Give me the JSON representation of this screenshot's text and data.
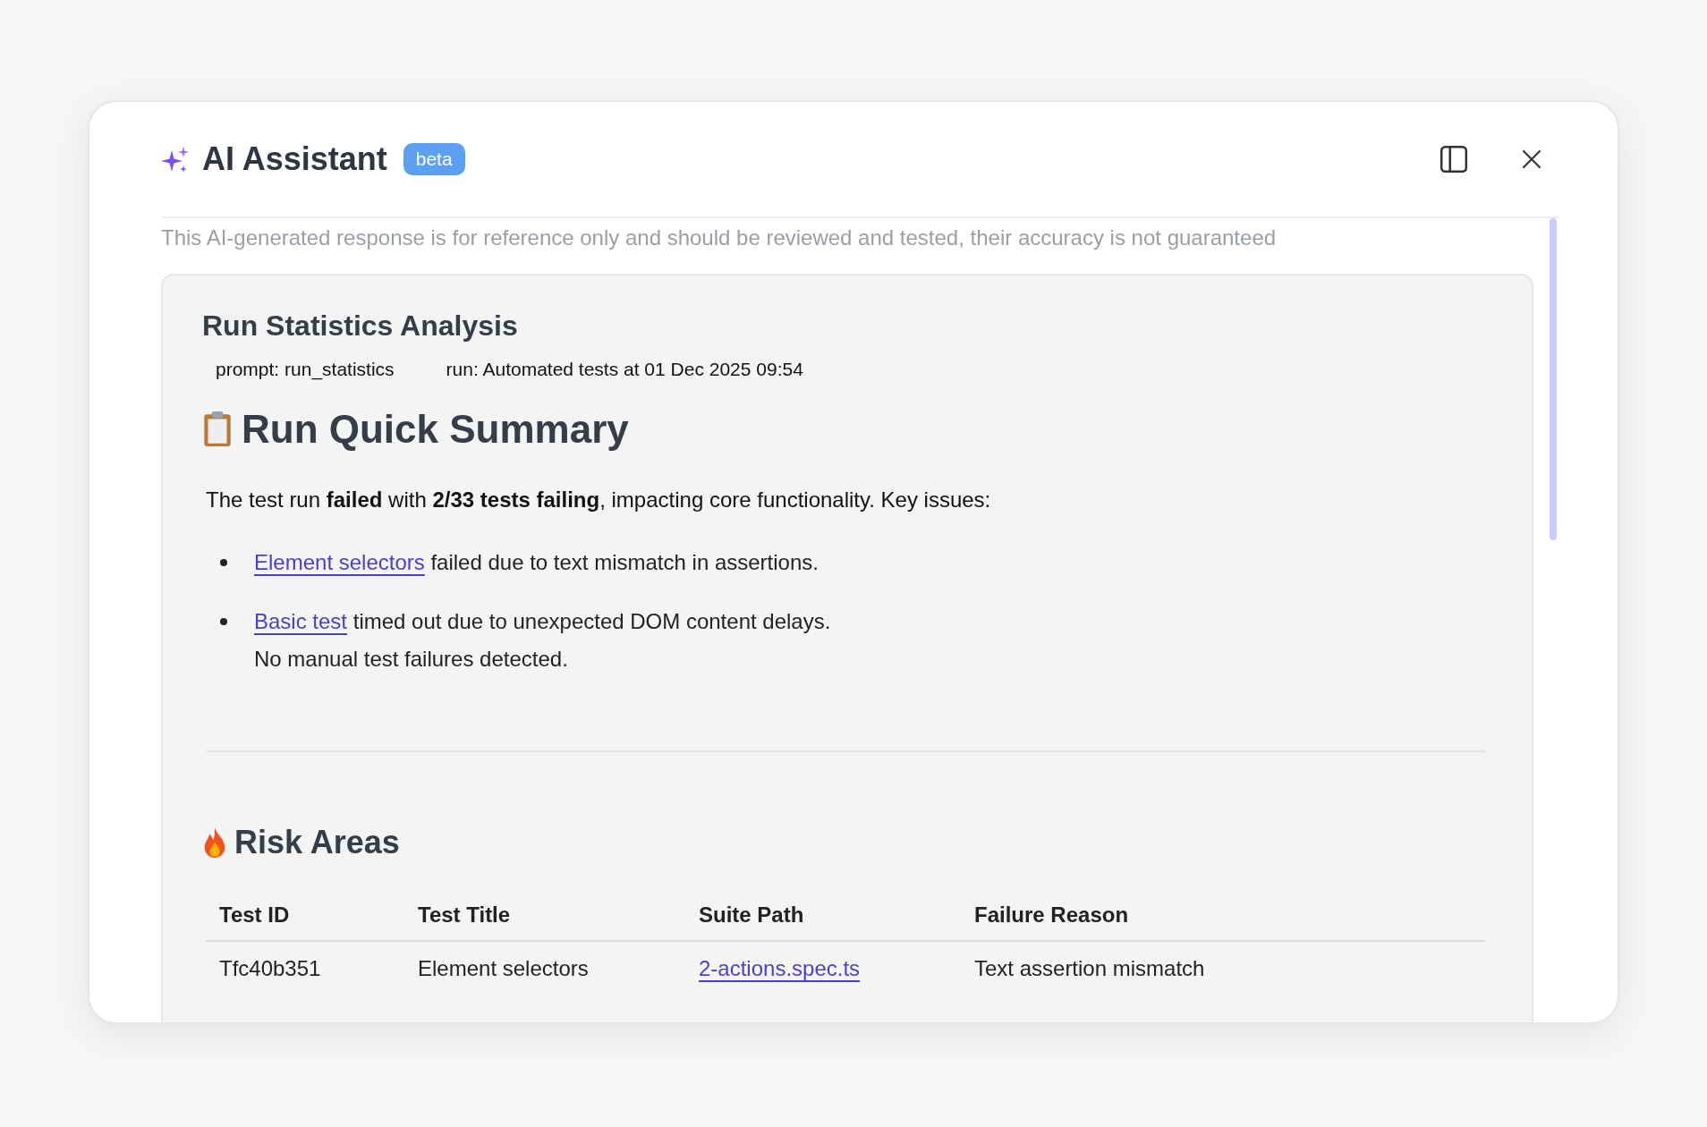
{
  "header": {
    "title": "AI Assistant",
    "badge": "beta"
  },
  "disclaimer": "This AI-generated response is for reference only and should be reviewed and tested, their accuracy is not guaranteed",
  "card": {
    "title": "Run Statistics Analysis",
    "meta": [
      "prompt: run_statistics",
      "run: Automated tests at 01 Dec 2025 09:54"
    ],
    "summary": {
      "heading": "Run Quick Summary",
      "paragraph": "The test run **failed** with **2/33 tests failing**, impacting core functionality. Key issues:",
      "bullets": [
        {
          "link": "Element selectors",
          "text": "failed due to text mismatch in assertions."
        },
        {
          "link": "Basic test",
          "text": "timed out due to unexpected DOM content delays."
        }
      ],
      "note": "No manual test failures detected."
    },
    "risk": {
      "heading": "Risk Areas",
      "columns": [
        "Test ID",
        "Test Title",
        "Suite Path",
        "Failure Reason"
      ],
      "rows": [
        {
          "id": "Tfc40b351",
          "title": "Element selectors",
          "path": "2-actions.spec.ts",
          "reason": "Text assertion mismatch"
        }
      ]
    }
  }
}
